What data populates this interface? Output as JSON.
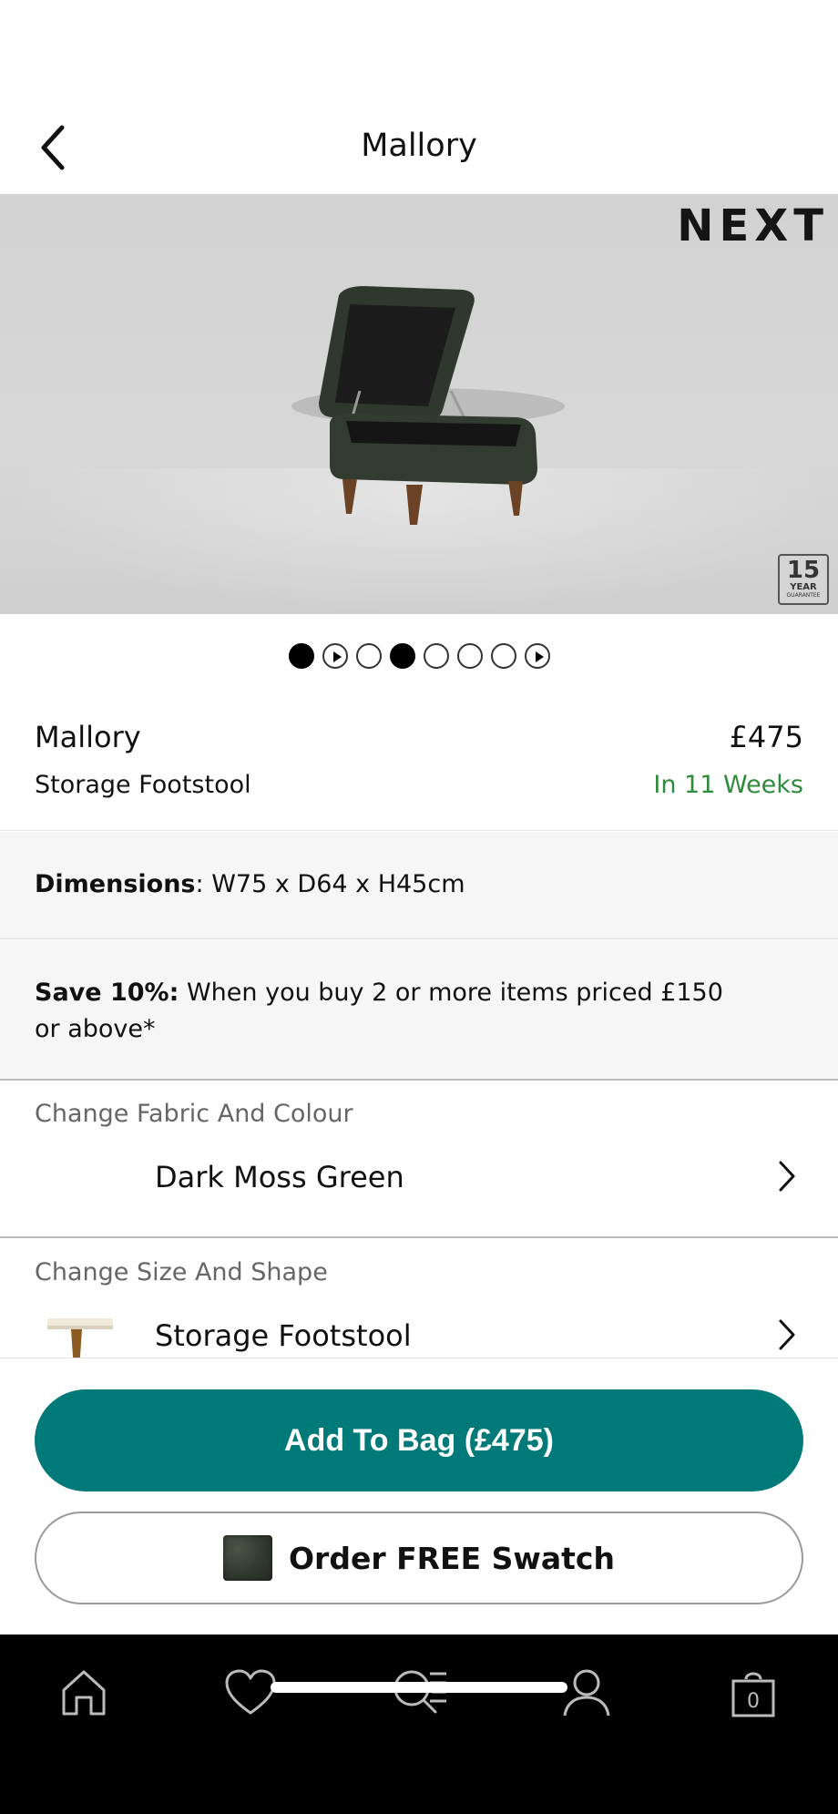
{
  "header": {
    "title": "Mallory",
    "back_icon": "chevron-left-icon"
  },
  "hero": {
    "brand_logo": "NEXT",
    "guarantee": {
      "number": "15",
      "unit": "YEAR",
      "label": "GUARANTEE"
    },
    "carousel": {
      "slides": [
        "image",
        "video",
        "image",
        "image",
        "image",
        "image",
        "image",
        "video"
      ],
      "active_index": 3
    }
  },
  "product": {
    "name": "Mallory",
    "price": "£475",
    "subtitle": "Storage Footstool",
    "delivery": "In 11 Weeks",
    "delivery_color": "#2e8b3a"
  },
  "dimensions": {
    "label": "Dimensions",
    "separator": ":",
    "value": " W75 x D64 x H45cm"
  },
  "promo": {
    "label": "Save 10%:",
    "text": " When you buy 2 or more items priced £150 or above*"
  },
  "options": {
    "fabric": {
      "label": "Change Fabric And Colour",
      "value": "Dark Moss Green"
    },
    "size": {
      "label": "Change Size And Shape",
      "value": "Storage Footstool"
    }
  },
  "actions": {
    "add_to_bag": "Add To Bag (£475)",
    "add_to_bag_color": "#007a78",
    "order_swatch": "Order FREE Swatch"
  },
  "tabbar": {
    "items": [
      {
        "name": "home",
        "icon": "home-icon"
      },
      {
        "name": "favourites",
        "icon": "heart-icon"
      },
      {
        "name": "search",
        "icon": "search-icon"
      },
      {
        "name": "account",
        "icon": "user-icon"
      },
      {
        "name": "bag",
        "icon": "bag-icon",
        "count": "0"
      }
    ]
  }
}
